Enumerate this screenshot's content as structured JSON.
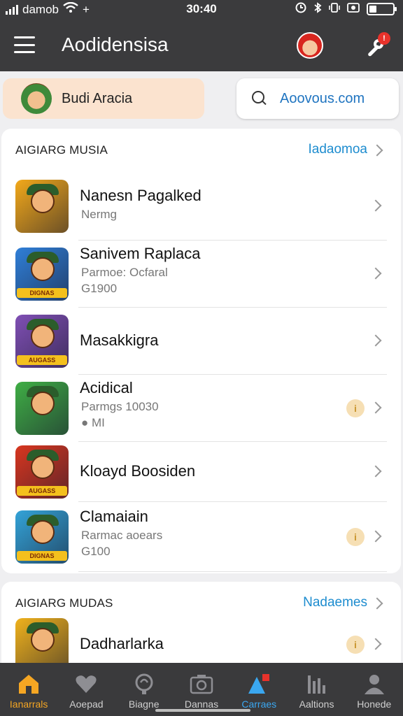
{
  "status_bar": {
    "carrier": "damob",
    "time": "30:40",
    "plus": "+"
  },
  "app_bar": {
    "title": "Aodidensisa",
    "tool_badge": "!"
  },
  "user_chip": {
    "name": "Budi Aracia"
  },
  "search_chip": {
    "text": "Aoovous.com"
  },
  "section1": {
    "title": "AIGIARG MUSIA",
    "link": "Iadaomoa",
    "items": [
      {
        "name": "Nanesn Pagalked",
        "sub1": "Nermg",
        "sub2": "",
        "icon_tag": "",
        "icon_color": "#f3a91a",
        "info": false
      },
      {
        "name": "Sanivem Raplaca",
        "sub1": "Parmoe: Ocfaral",
        "sub2": "G1900",
        "icon_tag": "DIGNAS",
        "icon_color": "#2f7fd8",
        "info": false
      },
      {
        "name": "Masakkigra",
        "sub1": "",
        "sub2": "",
        "icon_tag": "AUGASS",
        "icon_color": "#7f4fb4",
        "info": false
      },
      {
        "name": "Acidical",
        "sub1": "Parmgs 10030",
        "sub2": "● MI",
        "icon_tag": "",
        "icon_color": "#3fae45",
        "info": true
      },
      {
        "name": "Kloayd Boosiden",
        "sub1": "",
        "sub2": "",
        "icon_tag": "AUGASS",
        "icon_color": "#d8361f",
        "info": false
      },
      {
        "name": "Clamaiain",
        "sub1": "Rarmac aoears",
        "sub2": "G100",
        "icon_tag": "DIGNAS",
        "icon_color": "#33a3d8",
        "info": true
      }
    ]
  },
  "section2": {
    "title": "AIGIARG MUDAS",
    "link": "Nadaemes",
    "items": [
      {
        "name": "Dadharlarka",
        "sub1": "",
        "sub2": "",
        "icon_tag": "",
        "icon_color": "#f0b21c",
        "info": true
      }
    ]
  },
  "tab_bar": {
    "tabs": [
      {
        "label": "Ianarrals",
        "icon": "home-icon",
        "state": "active"
      },
      {
        "label": "Aoepad",
        "icon": "heart-icon",
        "state": ""
      },
      {
        "label": "Biagne",
        "icon": "globe-icon",
        "state": ""
      },
      {
        "label": "Dannas",
        "icon": "camera-icon",
        "state": ""
      },
      {
        "label": "Carraes",
        "icon": "shapes-icon",
        "state": "blue"
      },
      {
        "label": "Aaltions",
        "icon": "chart-icon",
        "state": ""
      },
      {
        "label": "Honede",
        "icon": "person-icon",
        "state": ""
      }
    ]
  },
  "colors": {
    "bar_bg": "#3b3b3d",
    "accent_orange": "#f5a623",
    "accent_blue": "#1d8ccf"
  }
}
